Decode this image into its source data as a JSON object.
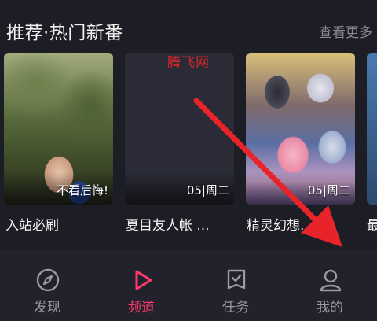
{
  "section": {
    "title": "推荐·热门新番",
    "more": "查看更多"
  },
  "cards": [
    {
      "tag": "不看后悔!",
      "title": "入站必刷"
    },
    {
      "tag": "05|周二",
      "title": "夏目友人帐 ..."
    },
    {
      "tag": "05|周二",
      "title": "精灵幻想..."
    },
    {
      "tag": "",
      "title": "最"
    }
  ],
  "watermark": "腾飞网",
  "tabbar": {
    "items": [
      {
        "label": "发现",
        "icon": "compass-icon"
      },
      {
        "label": "频道",
        "icon": "play-icon",
        "active": true
      },
      {
        "label": "任务",
        "icon": "task-icon"
      },
      {
        "label": "我的",
        "icon": "profile-icon"
      }
    ]
  },
  "colors": {
    "background": "#1d1d26",
    "tabbar": "#22222c",
    "accent": "#ff3a6d",
    "inactive": "#9a9aa4",
    "annotation": "#e8242a"
  }
}
